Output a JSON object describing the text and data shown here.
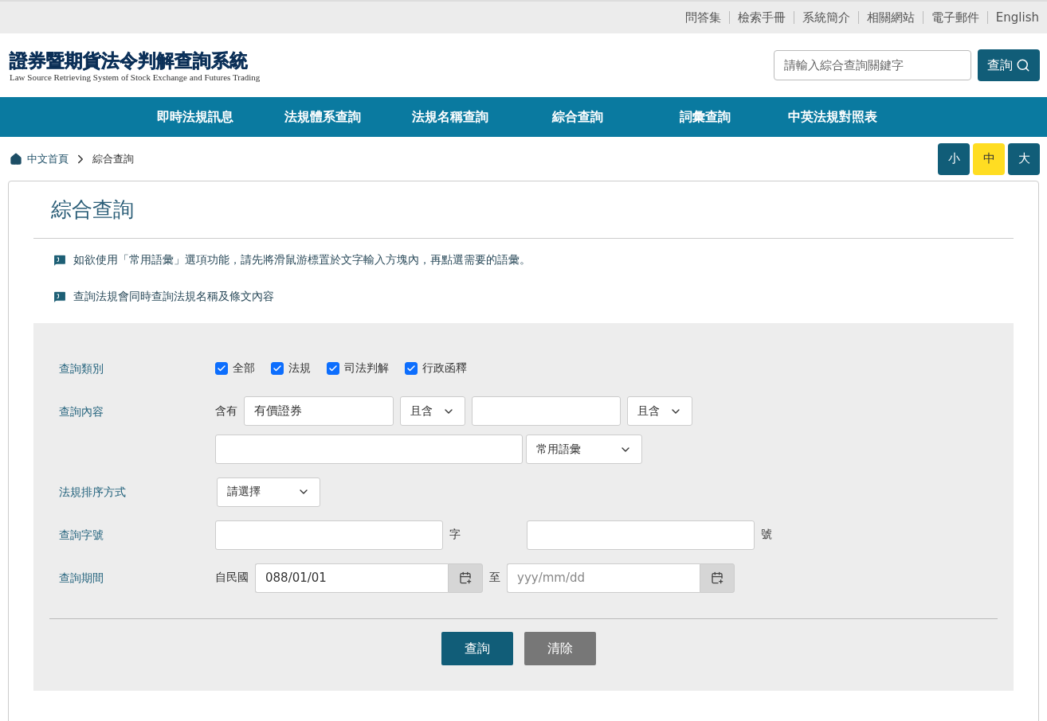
{
  "top_links": [
    "問答集",
    "檢索手冊",
    "系統簡介",
    "相關網站",
    "電子郵件",
    "English"
  ],
  "logo": {
    "title": "證券暨期貨法令判解查詢系統",
    "subtitle": "Law Source Retrieving System of Stock Exchange and Futures Trading"
  },
  "search": {
    "placeholder": "請輸入綜合查詢關鍵字",
    "button": "查詢"
  },
  "nav": [
    "即時法規訊息",
    "法規體系查詢",
    "法規名稱查詢",
    "綜合查詢",
    "詞彙查詢",
    "中英法規對照表"
  ],
  "breadcrumb": [
    "中文首頁",
    "綜合查詢"
  ],
  "font_sizes": [
    {
      "label": "小",
      "selected": false
    },
    {
      "label": "中",
      "selected": true
    },
    {
      "label": "大",
      "selected": false
    }
  ],
  "page_title": "綜合查詢",
  "notes": [
    "如欲使用「常用語彙」選項功能，請先將滑鼠游標置於文字輸入方塊內，再點選需要的語彙。",
    "查詢法規會同時查詢法規名稱及條文內容"
  ],
  "form": {
    "category": {
      "label": "查詢類別",
      "options": [
        {
          "label": "全部",
          "checked": true
        },
        {
          "label": "法規",
          "checked": true
        },
        {
          "label": "司法判解",
          "checked": true
        },
        {
          "label": "行政函釋",
          "checked": true
        }
      ]
    },
    "content": {
      "label": "查詢內容",
      "prefix": "含有",
      "term1": "有價證券",
      "op1": "且含",
      "op2": "且含",
      "phrase_select": "常用語彙"
    },
    "sort": {
      "label": "法規排序方式",
      "value": "請選擇"
    },
    "number": {
      "label": "查詢字號",
      "word_suffix": "字",
      "number_suffix": "號"
    },
    "period": {
      "label": "查詢期間",
      "from_prefix": "自民國",
      "from": "088/01/01",
      "to_prefix": "至",
      "to_placeholder": "yyy/mm/dd"
    }
  },
  "buttons": [
    {
      "label": "查詢",
      "kind": "primary"
    },
    {
      "label": "清除",
      "kind": "secondary"
    }
  ]
}
